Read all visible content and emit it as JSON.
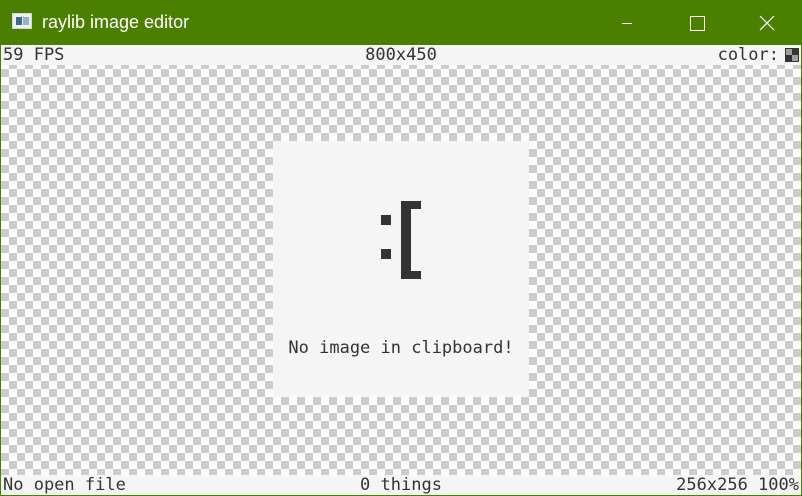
{
  "window": {
    "title": "raylib image editor",
    "icon": "app-window-icon",
    "controls": {
      "minimize_icon": "minimize-icon",
      "maximize_icon": "maximize-icon",
      "close_icon": "close-icon"
    }
  },
  "top_bar": {
    "fps": "59 FPS",
    "canvas_size": "800x450",
    "color_label": "color:",
    "color_swatch_icon": "color-swatch-icon"
  },
  "empty_state": {
    "face": ":[",
    "message": "No image in clipboard!"
  },
  "bottom_bar": {
    "file_status": "No open file",
    "things_count": "0 things",
    "image_info": "256x256 100%"
  },
  "colors": {
    "titlebar": "#4a7f00",
    "bar_background": "#f5f5f5",
    "text": "#333333",
    "checker_dark": "#cccccc",
    "checker_light": "#ffffff"
  }
}
